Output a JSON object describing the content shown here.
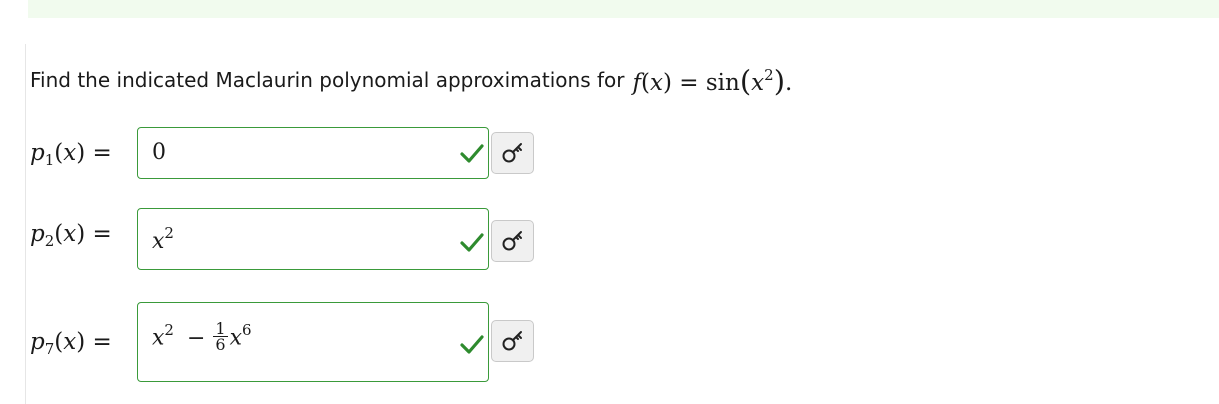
{
  "prompt": {
    "text": "Find the indicated Maclaurin polynomial approximations for",
    "function_lhs_name": "f",
    "function_var": "x",
    "equals": "=",
    "function_rhs_name": "sin",
    "period": "."
  },
  "rows": [
    {
      "label_name": "p",
      "label_sub": "1",
      "label_var": "x",
      "answer": "0",
      "status": "correct"
    },
    {
      "label_name": "p",
      "label_sub": "2",
      "label_var": "x",
      "answer_base": "x",
      "answer_exp": "2",
      "status": "correct"
    },
    {
      "label_name": "p",
      "label_sub": "7",
      "label_var": "x",
      "answer_base": "x",
      "answer_exp": "2",
      "answer_op": "−",
      "answer_frac_num": "1",
      "answer_frac_den": "6",
      "answer_base2": "x",
      "answer_exp2": "6",
      "status": "correct"
    }
  ],
  "colors": {
    "correct": "#2e8b2e",
    "box_border": "#3a9a3a",
    "banner": "#f1fbee",
    "preview_bg": "#f0f0f0"
  },
  "icons": {
    "status": "checkmark-icon",
    "preview": "key-icon"
  }
}
